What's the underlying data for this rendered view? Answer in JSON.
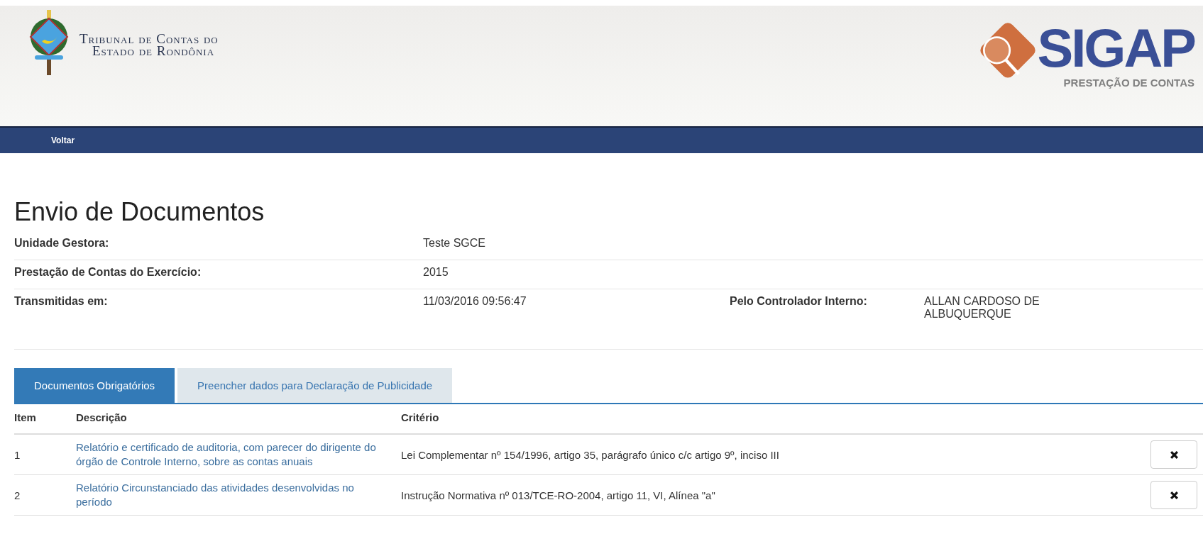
{
  "header": {
    "institution": [
      "Tribunal de Contas do",
      "Estado de Rondônia"
    ],
    "brand": "SIGAP",
    "brand_subtitle": "PRESTAÇÃO DE CONTAS"
  },
  "nav": {
    "items": [
      "Voltar"
    ]
  },
  "title": "Envio de Documentos",
  "details": [
    {
      "label": "Unidade Gestora:",
      "value": "Teste SGCE"
    },
    {
      "label": "Prestação de Contas do Exercício:",
      "value": "2015"
    },
    {
      "label": "Transmitidas em:",
      "value": "11/03/2016 09:56:47",
      "extra_label": "Pelo Controlador Interno:",
      "extra_value": "ALLAN CARDOSO DE ALBUQUERQUE"
    }
  ],
  "tabs": [
    {
      "label": "Documentos Obrigatórios",
      "selected": true
    },
    {
      "label": "Preencher dados para Declaração de Publicidade",
      "selected": false
    }
  ],
  "table": {
    "columns": [
      "Item",
      "Descrição",
      "Critério"
    ],
    "rows": [
      {
        "item": "1",
        "description": "Relatório e certificado de auditoria, com parecer do dirigente do órgão de Controle Interno, sobre as contas anuais",
        "criterion": "Lei Complementar nº 154/1996, artigo 35, parágrafo único c/c artigo 9º, inciso III"
      },
      {
        "item": "2",
        "description": "Relatório Circunstanciado das atividades desenvolvidas no período",
        "criterion": "Instrução Normativa nº 013/TCE-RO-2004, artigo 11, VI, Alínea \"a\""
      }
    ]
  }
}
